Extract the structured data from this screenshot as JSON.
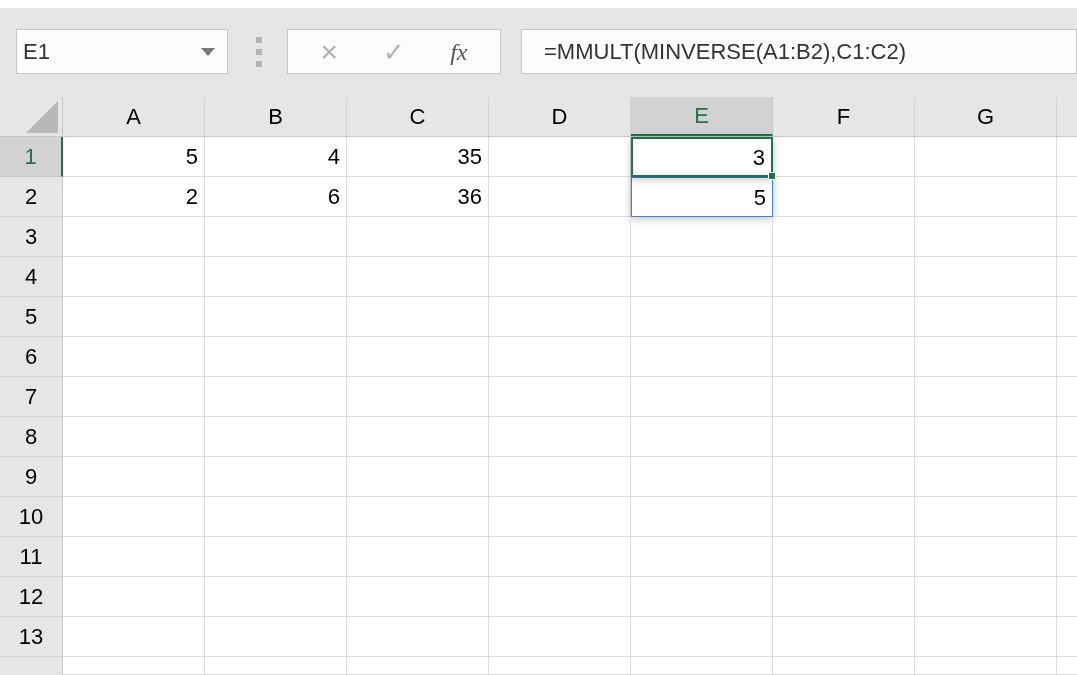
{
  "name_box": {
    "value": "E1"
  },
  "formula_bar": {
    "cancel": "×",
    "enter": "✓",
    "function": "fx",
    "value": "=MMULT(MINVERSE(A1:B2),C1:C2)"
  },
  "columns": [
    {
      "label": "A",
      "selected": false
    },
    {
      "label": "B",
      "selected": false
    },
    {
      "label": "C",
      "selected": false
    },
    {
      "label": "D",
      "selected": false
    },
    {
      "label": "E",
      "selected": true
    },
    {
      "label": "F",
      "selected": false
    },
    {
      "label": "G",
      "selected": false
    }
  ],
  "rows": [
    {
      "label": "1",
      "selected": true,
      "cells": [
        {
          "value": "5",
          "selected": false,
          "in_range": false
        },
        {
          "value": "4",
          "selected": false,
          "in_range": false
        },
        {
          "value": "35",
          "selected": false,
          "in_range": false
        },
        null,
        {
          "value": "3",
          "selected": true,
          "in_range": true
        },
        null,
        null
      ]
    },
    {
      "label": "2",
      "selected": false,
      "cells": [
        {
          "value": "2",
          "selected": false,
          "in_range": false
        },
        {
          "value": "6",
          "selected": false,
          "in_range": false
        },
        {
          "value": "36",
          "selected": false,
          "in_range": false
        },
        null,
        {
          "value": "5",
          "selected": false,
          "in_range": true
        },
        null,
        null
      ]
    },
    {
      "label": "3",
      "selected": false
    },
    {
      "label": "4",
      "selected": false
    },
    {
      "label": "5",
      "selected": false
    },
    {
      "label": "6",
      "selected": false
    },
    {
      "label": "7",
      "selected": false
    },
    {
      "label": "8",
      "selected": false
    },
    {
      "label": "9",
      "selected": false
    },
    {
      "label": "10",
      "selected": false
    },
    {
      "label": "11",
      "selected": false
    },
    {
      "label": "12",
      "selected": false
    },
    {
      "label": "13",
      "selected": false
    }
  ]
}
